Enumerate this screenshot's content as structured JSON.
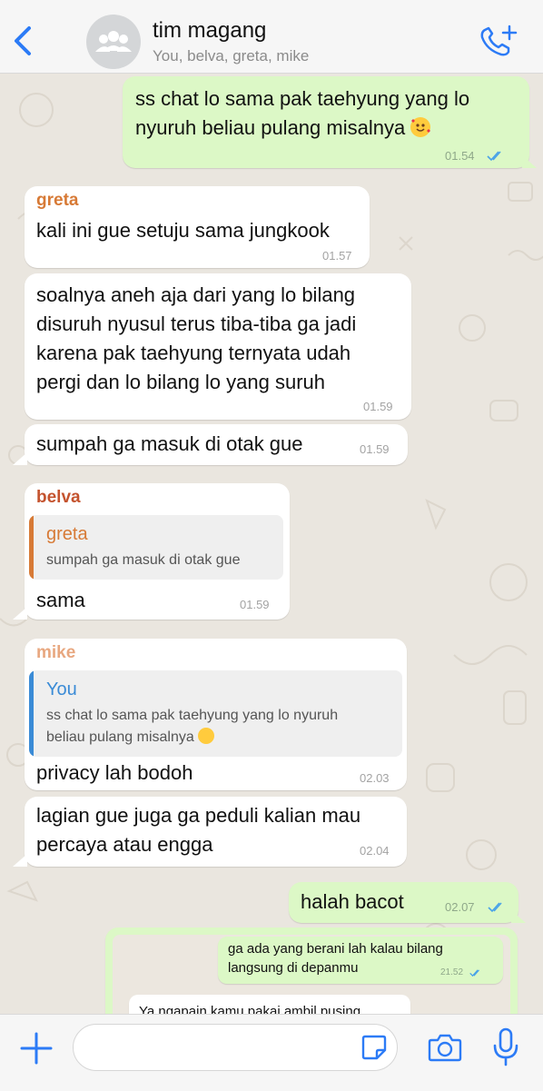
{
  "header": {
    "title": "tim magang",
    "subtitle": "You, belva, greta, mike"
  },
  "messages": {
    "m1": {
      "text": "ss chat lo sama pak taehyung yang lo\nnyuruh beliau pulang misalnya",
      "time": "01.54"
    },
    "m2": {
      "sender": "greta",
      "text": "kali ini gue setuju sama jungkook",
      "time": "01.57"
    },
    "m3": {
      "text": "soalnya aneh aja dari yang lo bilang\ndisuruh nyusul terus tiba-tiba ga jadi\nkarena pak taehyung ternyata udah\npergi dan lo bilang lo yang suruh",
      "time": "01.59"
    },
    "m4": {
      "text": "sumpah ga masuk di otak gue",
      "time": "01.59"
    },
    "m5": {
      "sender": "belva",
      "quote_name": "greta",
      "quote_text": "sumpah ga masuk di otak gue",
      "text": "sama",
      "time": "01.59"
    },
    "m6": {
      "sender": "mike",
      "quote_name": "You",
      "quote_text": "ss chat lo sama pak taehyung yang lo nyuruh\nbeliau pulang misalnya",
      "text": "privacy lah bodoh",
      "time": "02.03"
    },
    "m7": {
      "text": "lagian gue juga ga peduli kalian mau\npercaya atau engga",
      "time": "02.04"
    },
    "m8": {
      "text": "halah bacot",
      "time": "02.07"
    },
    "m9": {
      "inner_out_text": "ga ada yang berani lah kalau bilang\nlangsung di depanmu",
      "inner_out_time": "21.52",
      "inner_in_text": "Ya ngapain kamu pakai ambil pusing"
    }
  },
  "colors": {
    "greta": "#d77a36",
    "belva": "#c4532e",
    "mike": "#e8a77f",
    "you": "#3a8bd6",
    "accent_blue": "#2c7bf6",
    "outgoing_bubble": "#dcf8c6"
  },
  "icons": {
    "back": "chevron-left-icon",
    "avatar": "group-avatar-icon",
    "call": "add-call-icon",
    "attach": "plus-icon",
    "sticker": "sticker-icon",
    "camera": "camera-icon",
    "mic": "microphone-icon"
  }
}
